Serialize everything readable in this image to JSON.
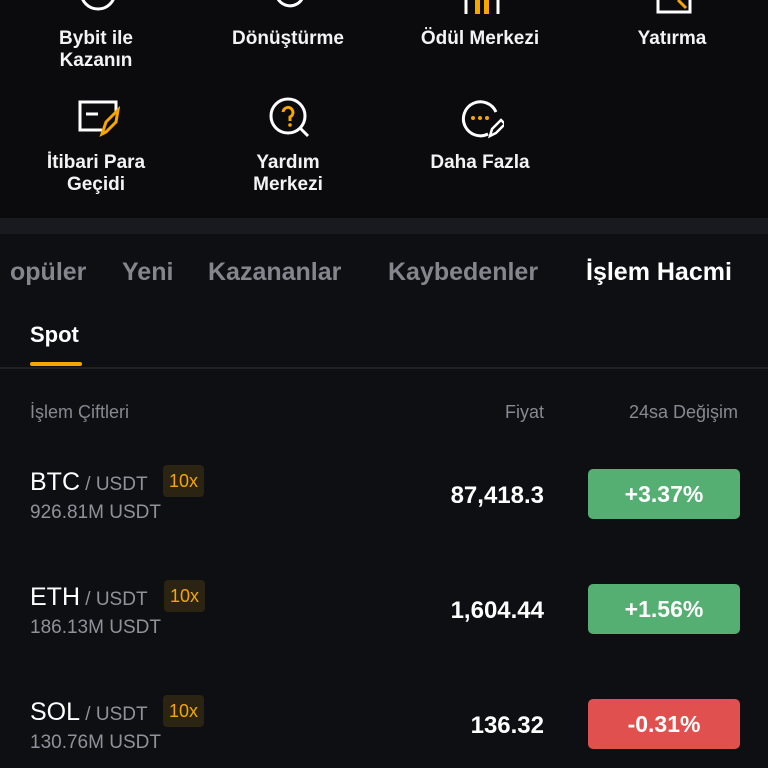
{
  "shortcuts": [
    {
      "label": "Bybit ile\nKazanın",
      "icon": "earn-coin-icon"
    },
    {
      "label": "Dönüştürme",
      "icon": "convert-icon"
    },
    {
      "label": "Ödül Merkezi",
      "icon": "gift-icon"
    },
    {
      "label": "Yatırma",
      "icon": "deposit-icon"
    },
    {
      "label": "İtibari Para\nGeçidi",
      "icon": "fiat-gateway-icon"
    },
    {
      "label": "Yardım\nMerkezi",
      "icon": "help-center-icon"
    },
    {
      "label": "Daha Fazla",
      "icon": "more-icon"
    }
  ],
  "tabs": [
    "opüler",
    "Yeni",
    "Kazananlar",
    "Kaybedenler",
    "İşlem Hacmi"
  ],
  "active_tab": "İşlem Hacmi",
  "subtab": "Spot",
  "columns": {
    "pair": "İşlem Çiftleri",
    "price": "Fiyat",
    "change": "24sa Değişim"
  },
  "rows": [
    {
      "base": "BTC",
      "quote": " / USDT",
      "leverage": "10x",
      "volume": "926.81M USDT",
      "price": "87,418.3",
      "change": "+3.37%",
      "direction": "up"
    },
    {
      "base": "ETH",
      "quote": " / USDT",
      "leverage": "10x",
      "volume": "186.13M USDT",
      "price": "1,604.44",
      "change": "+1.56%",
      "direction": "up"
    },
    {
      "base": "SOL",
      "quote": " / USDT",
      "leverage": "10x",
      "volume": "130.76M USDT",
      "price": "136.32",
      "change": "-0.31%",
      "direction": "down"
    }
  ],
  "colors": {
    "accent": "#f7a600",
    "up": "#55af72",
    "down": "#e0504e"
  }
}
